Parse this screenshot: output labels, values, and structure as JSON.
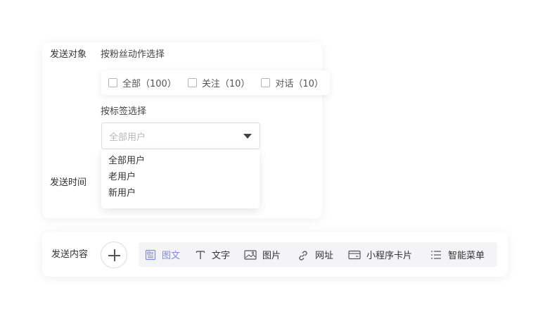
{
  "target": {
    "label": "发送对象",
    "by_action_label": "按粉丝动作选择",
    "checkboxes": [
      {
        "label": "全部（100）",
        "checked": false
      },
      {
        "label": "关注（10）",
        "checked": false
      },
      {
        "label": "对话（10）",
        "checked": false
      }
    ],
    "by_tag_label": "按标签选择",
    "select_placeholder": "全部用户",
    "dropdown_options": [
      "全部用户",
      "老用户",
      "新用户"
    ]
  },
  "time": {
    "label": "发送时间"
  },
  "content": {
    "label": "发送内容",
    "types": [
      {
        "label": "图文",
        "icon": "news-icon",
        "active": true
      },
      {
        "label": "文字",
        "icon": "text-icon",
        "active": false
      },
      {
        "label": "图片",
        "icon": "image-icon",
        "active": false
      },
      {
        "label": "网址",
        "icon": "link-icon",
        "active": false
      },
      {
        "label": "小程序卡片",
        "icon": "mini-program-card-icon",
        "active": false
      },
      {
        "label": "智能菜单",
        "icon": "menu-list-icon",
        "active": false
      }
    ]
  },
  "colors": {
    "accent": "#7f8bd9",
    "text": "#333333",
    "placeholder": "#b8b8b8"
  }
}
